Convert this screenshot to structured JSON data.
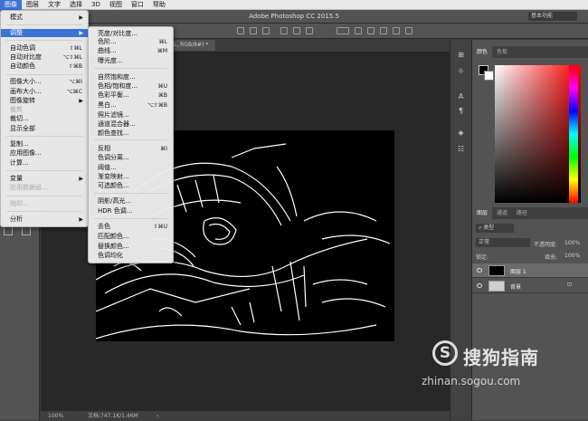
{
  "menubar": {
    "items": [
      "图像",
      "图层",
      "文字",
      "选择",
      "3D",
      "视图",
      "窗口",
      "帮助"
    ],
    "active_index": 0
  },
  "titlebar": {
    "title": "Adobe Photoshop CC 2015.5",
    "workspace": "基本功能"
  },
  "document": {
    "tab_label": "L, RGB/8#) *",
    "zoom": "100%",
    "doc_info": "文档:747.1K/1.46M"
  },
  "image_menu": {
    "rows": [
      {
        "label": "模式",
        "arrow": "▶"
      },
      {
        "label": "调整",
        "arrow": "▶",
        "highlight": true
      },
      {
        "label": "自动色调",
        "shortcut": "⇧⌘L"
      },
      {
        "label": "自动对比度",
        "shortcut": "⌥⇧⌘L"
      },
      {
        "label": "自动颜色",
        "shortcut": "⇧⌘B"
      },
      {
        "label": "图像大小...",
        "shortcut": "⌥⌘I"
      },
      {
        "label": "画布大小...",
        "shortcut": "⌥⌘C"
      },
      {
        "label": "图像旋转",
        "arrow": "▶"
      },
      {
        "label": "裁剪",
        "dim": true
      },
      {
        "label": "裁切..."
      },
      {
        "label": "显示全部"
      },
      {
        "label": "复制..."
      },
      {
        "label": "应用图像..."
      },
      {
        "label": "计算..."
      },
      {
        "label": "变量",
        "arrow": "▶"
      },
      {
        "label": "应用数据组...",
        "dim": true
      },
      {
        "label": "陷印...",
        "dim": true
      },
      {
        "label": "分析",
        "arrow": "▶"
      }
    ]
  },
  "adjust_menu": {
    "rows": [
      {
        "label": "亮度/对比度..."
      },
      {
        "label": "色阶...",
        "shortcut": "⌘L"
      },
      {
        "label": "曲线...",
        "shortcut": "⌘M"
      },
      {
        "label": "曝光度..."
      },
      {
        "label": "自然饱和度..."
      },
      {
        "label": "色相/饱和度...",
        "shortcut": "⌘U"
      },
      {
        "label": "色彩平衡...",
        "shortcut": "⌘B"
      },
      {
        "label": "黑白...",
        "shortcut": "⌥⇧⌘B"
      },
      {
        "label": "照片滤镜..."
      },
      {
        "label": "通道混合器..."
      },
      {
        "label": "颜色查找..."
      },
      {
        "label": "反相",
        "shortcut": "⌘I"
      },
      {
        "label": "色调分离..."
      },
      {
        "label": "阈值..."
      },
      {
        "label": "渐变映射..."
      },
      {
        "label": "可选颜色..."
      },
      {
        "label": "阴影/高光..."
      },
      {
        "label": "HDR 色调..."
      },
      {
        "label": "去色",
        "shortcut": "⇧⌘U"
      },
      {
        "label": "匹配颜色..."
      },
      {
        "label": "替换颜色..."
      },
      {
        "label": "色调均化"
      }
    ]
  },
  "color_panel": {
    "tabs": [
      "颜色",
      "色板"
    ]
  },
  "layers_panel": {
    "tabs": [
      "图层",
      "通道",
      "路径"
    ],
    "filter_label": "类型",
    "blend_mode": "正常",
    "opacity_label": "不透明度:",
    "opacity_value": "100%",
    "lock_label": "锁定:",
    "fill_label": "填充:",
    "fill_value": "100%",
    "layers": [
      {
        "name": "图层 1",
        "selected": true
      },
      {
        "name": "背景",
        "selected": false
      }
    ]
  },
  "watermark": {
    "brand": "搜狗指南",
    "url": "zhinan.sogou.com",
    "logo_letter": "S"
  },
  "colors": {
    "menu_highlight": "#3b73d6",
    "panel_bg": "#535353",
    "canvas_bg": "#282828"
  }
}
